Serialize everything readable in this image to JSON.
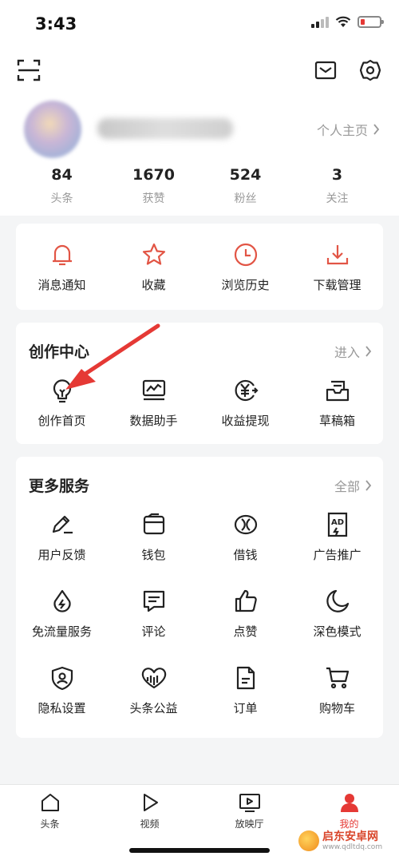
{
  "status": {
    "time": "3:43"
  },
  "profile": {
    "home_link": "个人主页"
  },
  "stats": [
    {
      "num": "84",
      "label": "头条"
    },
    {
      "num": "1670",
      "label": "获赞"
    },
    {
      "num": "524",
      "label": "粉丝"
    },
    {
      "num": "3",
      "label": "关注"
    }
  ],
  "quick": [
    {
      "label": "消息通知",
      "icon": "bell-icon"
    },
    {
      "label": "收藏",
      "icon": "star-icon"
    },
    {
      "label": "浏览历史",
      "icon": "clock-icon"
    },
    {
      "label": "下载管理",
      "icon": "download-icon"
    }
  ],
  "creation": {
    "title": "创作中心",
    "link": "进入",
    "items": [
      {
        "label": "创作首页",
        "icon": "lightbulb-icon"
      },
      {
        "label": "数据助手",
        "icon": "chart-icon"
      },
      {
        "label": "收益提现",
        "icon": "yuan-coin-icon"
      },
      {
        "label": "草稿箱",
        "icon": "drafts-icon"
      }
    ]
  },
  "services": {
    "title": "更多服务",
    "link": "全部",
    "items": [
      {
        "label": "用户反馈",
        "icon": "pen-icon"
      },
      {
        "label": "钱包",
        "icon": "wallet-icon"
      },
      {
        "label": "借钱",
        "icon": "loan-icon"
      },
      {
        "label": "广告推广",
        "icon": "ad-icon"
      },
      {
        "label": "免流量服务",
        "icon": "data-drop-icon"
      },
      {
        "label": "评论",
        "icon": "comment-icon"
      },
      {
        "label": "点赞",
        "icon": "thumbs-up-icon"
      },
      {
        "label": "深色模式",
        "icon": "moon-icon"
      },
      {
        "label": "隐私设置",
        "icon": "shield-icon"
      },
      {
        "label": "头条公益",
        "icon": "heart-chart-icon"
      },
      {
        "label": "订单",
        "icon": "order-icon"
      },
      {
        "label": "购物车",
        "icon": "cart-icon"
      }
    ]
  },
  "tabs": [
    {
      "label": "头条",
      "icon": "home-icon",
      "active": false
    },
    {
      "label": "视频",
      "icon": "play-icon",
      "active": false
    },
    {
      "label": "放映厅",
      "icon": "tv-icon",
      "active": false
    },
    {
      "label": "我的",
      "icon": "person-icon",
      "active": true
    }
  ],
  "colors": {
    "accent": "#e53935",
    "quick_icon": "#e25545"
  },
  "watermark": {
    "title": "启东安卓网",
    "url": "www.qdltdq.com"
  }
}
